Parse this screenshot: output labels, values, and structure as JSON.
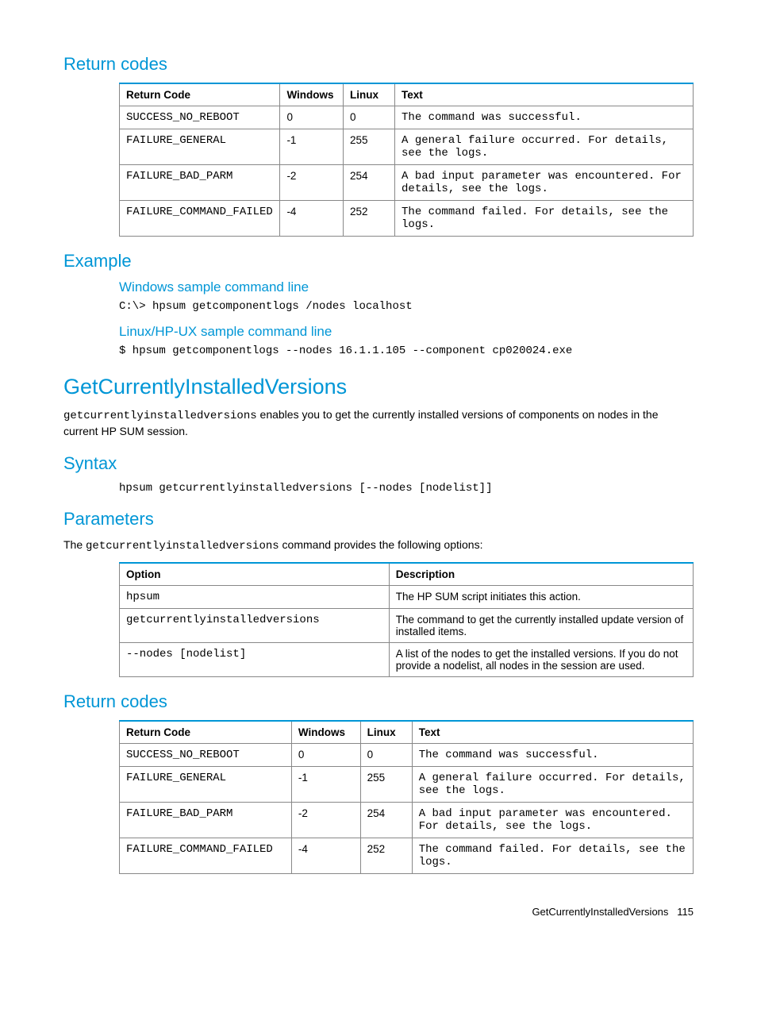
{
  "sections": {
    "return_codes_1": "Return codes",
    "example": "Example",
    "windows_sample": "Windows sample command line",
    "linux_sample": "Linux/HP-UX sample command line",
    "getcurrent": "GetCurrentlyInstalledVersions",
    "syntax": "Syntax",
    "parameters": "Parameters",
    "return_codes_2": "Return codes"
  },
  "table_returncodes_1": {
    "headers": [
      "Return Code",
      "Windows",
      "Linux",
      "Text"
    ],
    "rows": [
      [
        "SUCCESS_NO_REBOOT",
        "0",
        "0",
        "The command was successful."
      ],
      [
        "FAILURE_GENERAL",
        "-1",
        "255",
        "A general failure occurred. For details, see the logs."
      ],
      [
        "FAILURE_BAD_PARM",
        "-2",
        "254",
        "A bad input parameter was encountered. For details, see the logs."
      ],
      [
        "FAILURE_COMMAND_FAILED",
        "-4",
        "252",
        "The command failed. For details, see the logs."
      ]
    ]
  },
  "example_windows": "C:\\> hpsum getcomponentlogs /nodes localhost",
  "example_linux": "$ hpsum getcomponentlogs --nodes 16.1.1.105 --component cp020024.exe",
  "getcurrent_intro_code": "getcurrentlyinstalledversions",
  "getcurrent_intro_rest": " enables you to get the currently installed versions of components on nodes in the current HP SUM session.",
  "syntax_code": "hpsum getcurrentlyinstalledversions [--nodes [nodelist]]",
  "parameters_intro_pre": "The ",
  "parameters_intro_code": "getcurrentlyinstalledversions",
  "parameters_intro_post": " command provides the following options:",
  "table_parameters": {
    "headers": [
      "Option",
      "Description"
    ],
    "rows": [
      [
        "hpsum",
        "The HP SUM script initiates this action."
      ],
      [
        "getcurrentlyinstalledversions",
        "The command to get the currently installed update version of installed items."
      ],
      [
        "--nodes [nodelist]",
        "A list of the nodes to get the installed versions. If you do not provide a nodelist, all nodes in the session are used."
      ]
    ]
  },
  "table_returncodes_2": {
    "headers": [
      "Return Code",
      "Windows",
      "Linux",
      "Text"
    ],
    "rows": [
      [
        "SUCCESS_NO_REBOOT",
        "0",
        "0",
        "The command was successful."
      ],
      [
        "FAILURE_GENERAL",
        "-1",
        "255",
        "A general failure occurred. For details, see the logs."
      ],
      [
        "FAILURE_BAD_PARM",
        "-2",
        "254",
        "A bad input parameter was encountered. For details, see the logs."
      ],
      [
        "FAILURE_COMMAND_FAILED",
        "-4",
        "252",
        "The command failed. For details, see the logs."
      ]
    ]
  },
  "footer_title": "GetCurrentlyInstalledVersions",
  "footer_page": "115"
}
